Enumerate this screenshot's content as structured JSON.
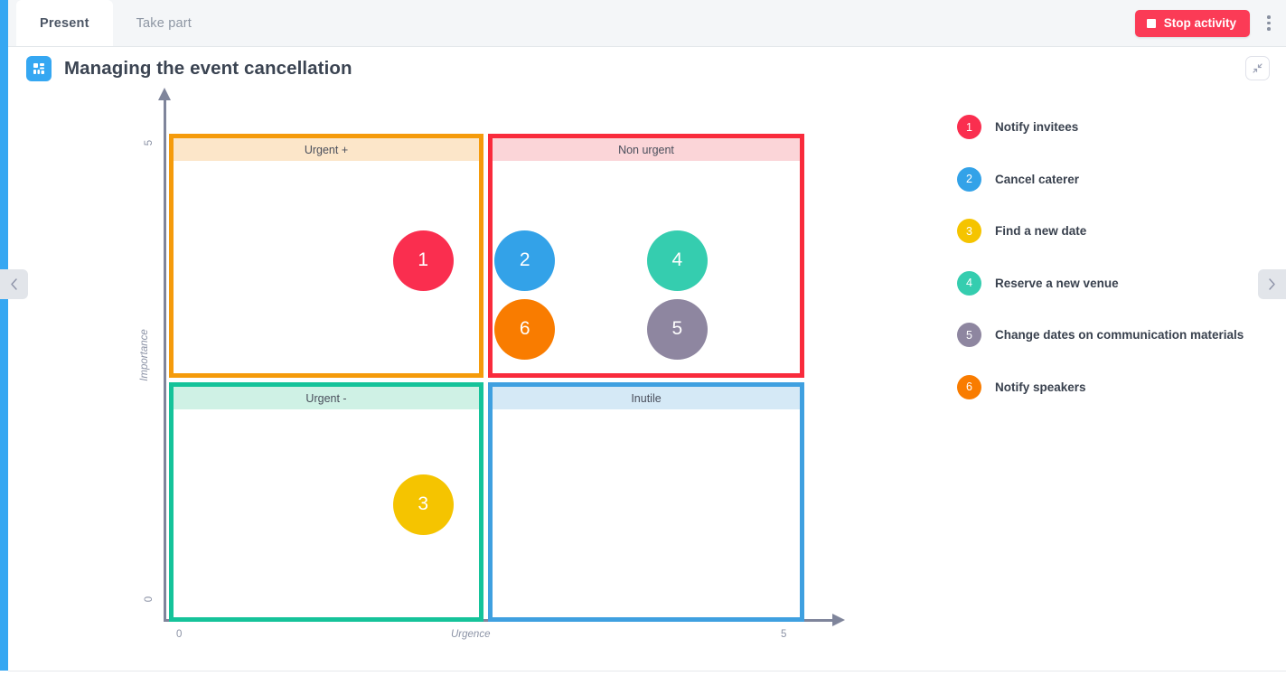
{
  "app": {
    "tabs": [
      {
        "label": "Present",
        "active": true
      },
      {
        "label": "Take part",
        "active": false
      }
    ],
    "stop_button_label": "Stop activity",
    "kebab_icon": "more-vertical-icon",
    "left_nav_icon": "chevron-left-icon",
    "right_nav_icon": "chevron-right-icon"
  },
  "header": {
    "title": "Managing the event cancellation",
    "doc_icon": "matrix-grid-icon",
    "expand_icon": "collapse-diagonal-icon"
  },
  "chart_data": {
    "type": "scatter",
    "title": "Managing the event cancellation",
    "xlabel": "Urgence",
    "ylabel": "Importance",
    "xlim": [
      0,
      5
    ],
    "ylim": [
      0,
      5
    ],
    "x_ticks": [
      "0",
      "5"
    ],
    "y_ticks": [
      "0",
      "5"
    ],
    "grid": false,
    "legend_position": "right",
    "quadrants": [
      {
        "id": "top-left",
        "label": "Urgent +",
        "border": "#F59B0B",
        "band": "#FCE6C9"
      },
      {
        "id": "top-right",
        "label": "Non urgent",
        "border": "#F92B3C",
        "band": "#FBD5D8"
      },
      {
        "id": "bottom-left",
        "label": "Urgent -",
        "border": "#15C39A",
        "band": "#CFF1E5"
      },
      {
        "id": "bottom-right",
        "label": "Inutile",
        "border": "#3FA0E0",
        "band": "#D5E9F6"
      }
    ],
    "points": [
      {
        "id": "1",
        "label": "Notify invitees",
        "color": "#FA2E4F",
        "x": 2.0,
        "y": 3.7,
        "quadrant": "top-left",
        "size": 67
      },
      {
        "id": "2",
        "label": "Cancel caterer",
        "color": "#33A2E8",
        "x": 2.8,
        "y": 3.7,
        "quadrant": "top-left",
        "size": 67
      },
      {
        "id": "3",
        "label": "Find a new date",
        "color": "#F5C400",
        "x": 2.0,
        "y": 1.2,
        "quadrant": "bottom-left",
        "size": 67
      },
      {
        "id": "4",
        "label": "Reserve a new venue",
        "color": "#35CDAF",
        "x": 4.0,
        "y": 3.7,
        "quadrant": "top-right",
        "size": 67
      },
      {
        "id": "5",
        "label": "Change dates on communication materials",
        "color": "#8E86A0",
        "x": 4.0,
        "y": 3.0,
        "quadrant": "top-right",
        "size": 67
      },
      {
        "id": "6",
        "label": "Notify speakers",
        "color": "#F97C00",
        "x": 2.8,
        "y": 3.0,
        "quadrant": "top-left",
        "size": 67
      }
    ]
  },
  "legend": [
    {
      "num": "1",
      "label": "Notify invitees",
      "color": "#FA2E4F"
    },
    {
      "num": "2",
      "label": "Cancel caterer",
      "color": "#33A2E8"
    },
    {
      "num": "3",
      "label": "Find a new date",
      "color": "#F5C400"
    },
    {
      "num": "4",
      "label": "Reserve a new venue",
      "color": "#35CDAF"
    },
    {
      "num": "5",
      "label": "Change dates on communication materials",
      "color": "#8E86A0"
    },
    {
      "num": "6",
      "label": "Notify speakers",
      "color": "#F97C00"
    }
  ],
  "theme": {
    "accent": "#35A7F2",
    "stop_red": "#FB3B56",
    "axis_gray": "#7F859B"
  }
}
